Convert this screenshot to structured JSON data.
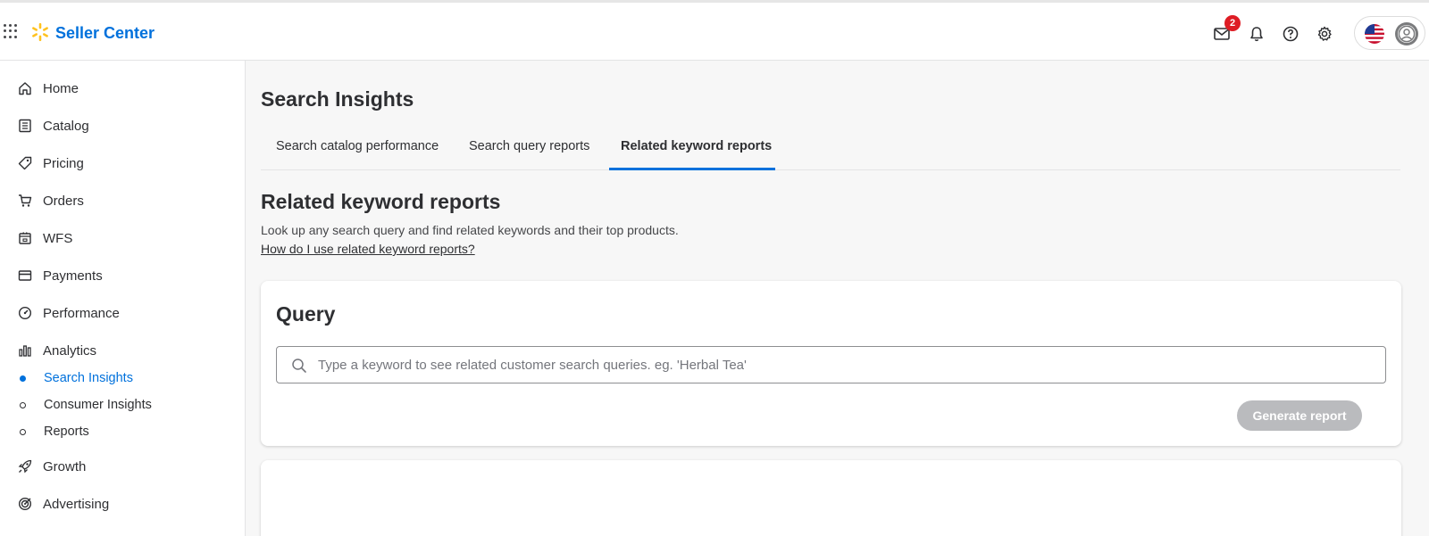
{
  "header": {
    "brand": "Seller Center",
    "mail_badge": "2",
    "icons": [
      "apps-grid-icon",
      "spark-logo-icon",
      "mail-icon",
      "bell-icon",
      "help-icon",
      "gear-icon",
      "us-flag-icon",
      "avatar-icon"
    ]
  },
  "sidebar": {
    "items": [
      {
        "label": "Home",
        "icon": "home-icon"
      },
      {
        "label": "Catalog",
        "icon": "catalog-icon"
      },
      {
        "label": "Pricing",
        "icon": "tag-icon"
      },
      {
        "label": "Orders",
        "icon": "cart-icon"
      },
      {
        "label": "WFS",
        "icon": "box-icon"
      },
      {
        "label": "Payments",
        "icon": "card-icon"
      },
      {
        "label": "Performance",
        "icon": "gauge-icon"
      },
      {
        "label": "Analytics",
        "icon": "bar-chart-icon"
      },
      {
        "label": "Growth",
        "icon": "rocket-icon"
      },
      {
        "label": "Advertising",
        "icon": "target-icon"
      }
    ],
    "subitems": [
      {
        "label": "Search Insights",
        "active": true
      },
      {
        "label": "Consumer Insights",
        "active": false
      },
      {
        "label": "Reports",
        "active": false
      }
    ]
  },
  "main": {
    "title": "Search Insights",
    "tabs": [
      {
        "label": "Search catalog performance",
        "active": false
      },
      {
        "label": "Search query reports",
        "active": false
      },
      {
        "label": "Related keyword reports",
        "active": true
      }
    ],
    "section_title": "Related keyword reports",
    "section_desc": "Look up any search query and find related keywords and their top products.",
    "help_link": "How do I use related keyword reports?",
    "query_card": {
      "title": "Query",
      "search_placeholder": "Type a keyword to see related customer search queries. eg. 'Herbal Tea'",
      "search_value": "",
      "generate_button": "Generate report",
      "generate_enabled": false
    }
  },
  "colors": {
    "accent": "#0071dc",
    "spark": "#ffc220",
    "badge": "#de1c24",
    "disabled_button": "#babbbe"
  }
}
